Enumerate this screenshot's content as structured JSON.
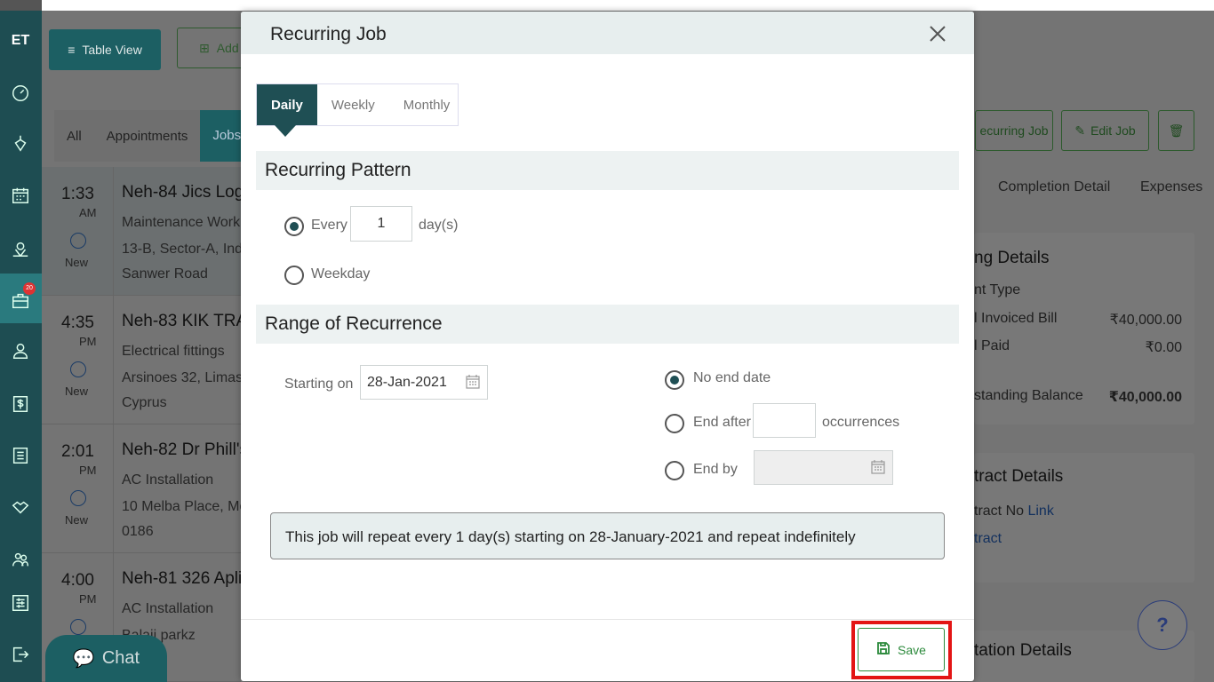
{
  "sidebar": {
    "logo": "ET",
    "badge_count": "20",
    "icons": [
      "dashboard-icon",
      "diamond-icon",
      "calendar-icon",
      "map-pin-icon",
      "briefcase-icon",
      "user-icon",
      "dollar-icon",
      "list-icon",
      "handshake-icon",
      "users-icon",
      "settings-icon",
      "logout-icon"
    ]
  },
  "background": {
    "table_view_label": "Table View",
    "add_label": "Add",
    "tabs": [
      "All",
      "Appointments",
      "Jobs"
    ],
    "jobs": [
      {
        "time": "1:33",
        "ampm": "AM",
        "status": "New",
        "title": "Neh-84 Jics Logi",
        "line1": "Maintenance Work",
        "line2": "13-B, Sector-A, Ind",
        "line3": "Sanwer Road"
      },
      {
        "time": "4:35",
        "ampm": "PM",
        "status": "New",
        "title": "Neh-83 KIK TRA",
        "line1": "Electrical fittings",
        "line2": "Arsinoes 32, Limass",
        "line3": "Cyprus"
      },
      {
        "time": "2:01",
        "ampm": "PM",
        "status": "New",
        "title": "Neh-82 Dr Phill's",
        "line1": "AC Installation",
        "line2": "10 Melba Place, Mo",
        "line3": "0186"
      },
      {
        "time": "4:00",
        "ampm": "PM",
        "status": "",
        "title": "Neh-81 326 Apli",
        "line1": "AC Installation",
        "line2": "Balaji parkz",
        "line3": ""
      }
    ],
    "recurring_job_label": "ecurring Job",
    "edit_job_label": "Edit Job",
    "completion_detail_tab": "Completion Detail",
    "expenses_tab": "Expenses",
    "billing": {
      "title": "ng Details",
      "row1": "nt Type",
      "row2_label": "l Invoiced Bill",
      "row2_value": "₹40,000.00",
      "row3_label": "l Paid",
      "row3_value": "₹0.00",
      "row4_label": "standing Balance",
      "row4_value": "₹40,000.00"
    },
    "contract": {
      "title": "tract Details",
      "row1_label": "tract No",
      "row1_link": "Link",
      "row2_link": "tract"
    },
    "quotation_title": "tation Details",
    "help_label": "?",
    "chat_label": "Chat"
  },
  "modal": {
    "title": "Recurring Job",
    "tabs": [
      "Daily",
      "Weekly",
      "Monthly"
    ],
    "recurring_pattern_title": "Recurring Pattern",
    "every_label": "Every",
    "every_value": "1",
    "days_label": "day(s)",
    "weekday_label": "Weekday",
    "range_title": "Range of Recurrence",
    "starting_on_label": "Starting on",
    "starting_on_value": "28-Jan-2021",
    "no_end_date_label": "No end date",
    "end_after_label": "End after",
    "occurrences_label": "occurrences",
    "end_by_label": "End by",
    "summary": "This job will repeat every 1 day(s) starting on 28-January-2021 and repeat indefinitely",
    "save_label": "Save"
  },
  "colors": {
    "primary": "#1f4f54",
    "save_green": "#2c8a3c",
    "highlight_red": "#e31515"
  }
}
